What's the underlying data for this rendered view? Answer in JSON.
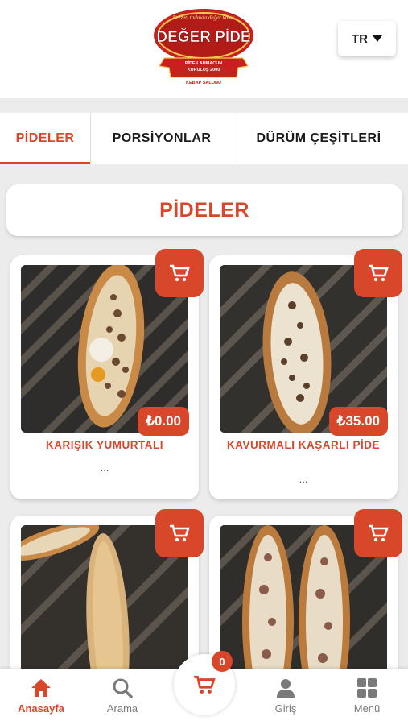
{
  "header": {
    "logo_text": "DEĞER PİDE",
    "logo_tagline": "Lezzeti tadında değer katar",
    "logo_sub1": "PİDE-LAHMACUN",
    "logo_sub2": "KURULUŞ 2000",
    "logo_sub3": "KEBAP SALONU",
    "language": "TR"
  },
  "tabs": [
    {
      "label": "PİDELER",
      "active": true
    },
    {
      "label": "PORSİYONLAR",
      "active": false
    },
    {
      "label": "DÜRÜM ÇEŞİTLERİ",
      "active": false
    }
  ],
  "section": {
    "title": "PİDELER"
  },
  "products": [
    {
      "name": "KARIŞIK YUMURTALI",
      "price": "₺0.00",
      "desc": "..."
    },
    {
      "name": "KAVURMALI KAŞARLI PİDE",
      "price": "₺35.00",
      "desc": "..."
    },
    {
      "name": "",
      "price": "",
      "desc": ""
    },
    {
      "name": "",
      "price": "",
      "desc": ""
    }
  ],
  "cart": {
    "count": "0"
  },
  "bottom_nav": [
    {
      "label": "Anasayfa",
      "icon": "home-icon",
      "active": true
    },
    {
      "label": "Arama",
      "icon": "search-icon",
      "active": false
    },
    {
      "label": "Giriş",
      "icon": "user-icon",
      "active": false
    },
    {
      "label": "Menü",
      "icon": "grid-icon",
      "active": false
    }
  ],
  "colors": {
    "accent": "#d9472b",
    "background": "#ececec"
  }
}
